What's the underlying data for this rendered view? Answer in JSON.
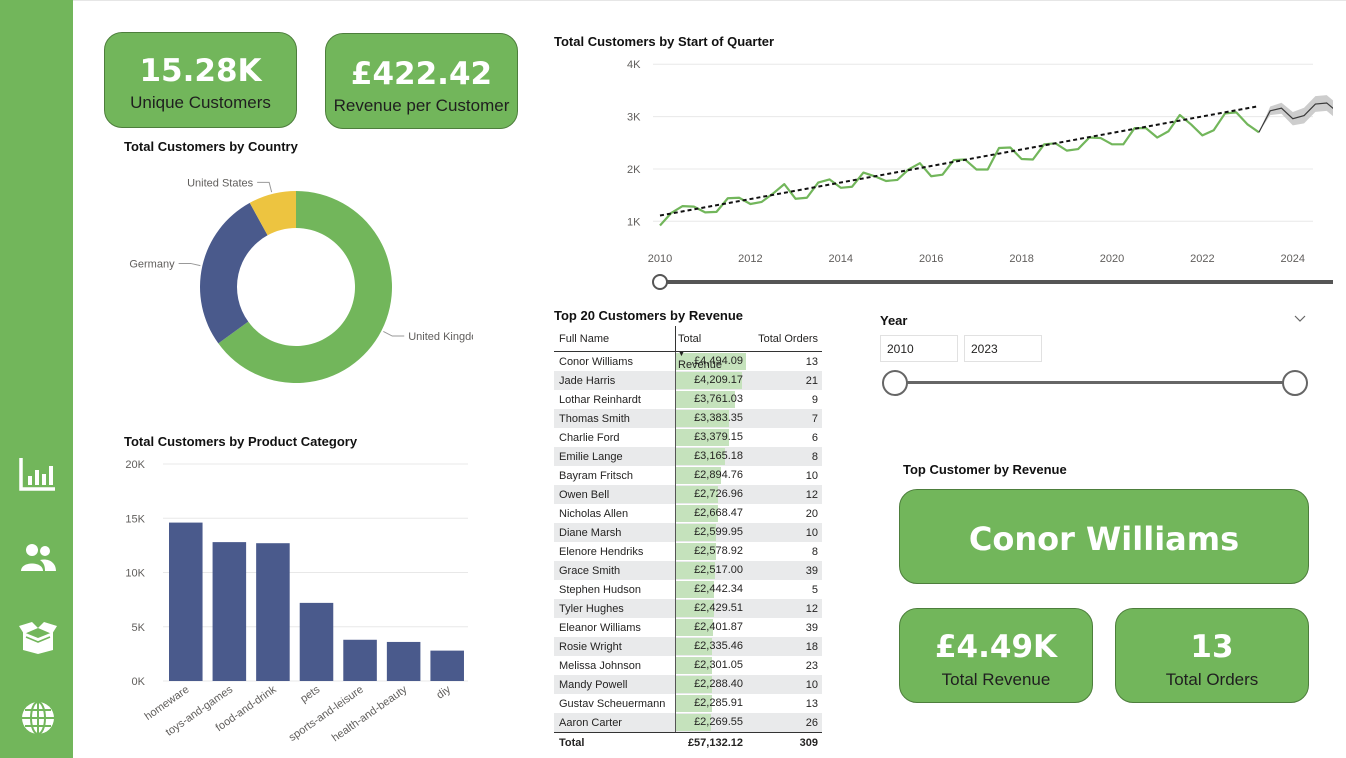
{
  "nav": [
    {
      "name": "report-icon"
    },
    {
      "name": "customers-icon"
    },
    {
      "name": "products-icon"
    },
    {
      "name": "globe-icon"
    }
  ],
  "kpis": {
    "unique_customers": {
      "value": "15.28K",
      "label": "Unique Customers"
    },
    "revenue_per_customer": {
      "value": "£422.42",
      "label": "Revenue per Customer"
    }
  },
  "country_chart": {
    "title": "Total Customers by Country",
    "chart_data": {
      "type": "pie",
      "categories": [
        "United Kingdom",
        "Germany",
        "United States"
      ],
      "values": [
        65,
        27,
        8
      ],
      "colors": [
        "#72b65b",
        "#4a5a8c",
        "#edc440"
      ]
    }
  },
  "category_chart": {
    "title": "Total Customers by Product Category",
    "chart_data": {
      "type": "bar",
      "categories": [
        "homeware",
        "toys-and-games",
        "food-and-drink",
        "pets",
        "sports-and-leisure",
        "health-and-beauty",
        "diy"
      ],
      "values": [
        14600,
        12800,
        12700,
        7200,
        3800,
        3600,
        2800
      ],
      "ylim": [
        0,
        20000
      ],
      "yticks": [
        "0K",
        "5K",
        "10K",
        "15K",
        "20K"
      ],
      "color": "#4a5a8c"
    }
  },
  "line_chart": {
    "title": "Total Customers by Start of Quarter",
    "chart_data": {
      "type": "line",
      "x_ticks": [
        "2010",
        "2012",
        "2014",
        "2016",
        "2018",
        "2020",
        "2022",
        "2024"
      ],
      "y_ticks": [
        "1K",
        "2K",
        "3K",
        "4K"
      ],
      "ylim": [
        700,
        4100
      ],
      "x_start": 2010.0,
      "x_step": 0.25,
      "actual": [
        920,
        1160,
        1290,
        1280,
        1170,
        1180,
        1440,
        1450,
        1330,
        1370,
        1530,
        1710,
        1430,
        1450,
        1740,
        1800,
        1640,
        1660,
        1930,
        1860,
        1770,
        1790,
        1990,
        2110,
        1860,
        1890,
        2170,
        2180,
        1990,
        1990,
        2400,
        2410,
        2190,
        2180,
        2470,
        2490,
        2350,
        2380,
        2600,
        2590,
        2470,
        2470,
        2780,
        2780,
        2600,
        2720,
        3030,
        2850,
        2640,
        2740,
        3060,
        3080,
        2850,
        2700
      ],
      "forecast": [
        2700,
        3110,
        3160,
        2960,
        3020,
        3240,
        3260,
        3080,
        3120,
        3380,
        3430
      ],
      "forecast_band": 150,
      "trend": [
        1110,
        3200
      ],
      "colors": {
        "actual": "#72b65b",
        "forecast": "#3a3a3a",
        "band": "#c8c8c8",
        "trend": "#111111"
      }
    }
  },
  "top20": {
    "title": "Top 20 Customers by Revenue",
    "columns": [
      "Full Name",
      "Total Revenue",
      "Total Orders"
    ],
    "rows": [
      {
        "name": "Conor Williams",
        "revenue": "£4,494.09",
        "orders": "13",
        "rev": 4494.09
      },
      {
        "name": "Jade Harris",
        "revenue": "£4,209.17",
        "orders": "21",
        "rev": 4209.17
      },
      {
        "name": "Lothar Reinhardt",
        "revenue": "£3,761.03",
        "orders": "9",
        "rev": 3761.03
      },
      {
        "name": "Thomas Smith",
        "revenue": "£3,383.35",
        "orders": "7",
        "rev": 3383.35
      },
      {
        "name": "Charlie Ford",
        "revenue": "£3,379.15",
        "orders": "6",
        "rev": 3379.15
      },
      {
        "name": "Emilie Lange",
        "revenue": "£3,165.18",
        "orders": "8",
        "rev": 3165.18
      },
      {
        "name": "Bayram Fritsch",
        "revenue": "£2,894.76",
        "orders": "10",
        "rev": 2894.76
      },
      {
        "name": "Owen Bell",
        "revenue": "£2,726.96",
        "orders": "12",
        "rev": 2726.96
      },
      {
        "name": "Nicholas Allen",
        "revenue": "£2,668.47",
        "orders": "20",
        "rev": 2668.47
      },
      {
        "name": "Diane Marsh",
        "revenue": "£2,599.95",
        "orders": "10",
        "rev": 2599.95
      },
      {
        "name": "Elenore Hendriks",
        "revenue": "£2,578.92",
        "orders": "8",
        "rev": 2578.92
      },
      {
        "name": "Grace Smith",
        "revenue": "£2,517.00",
        "orders": "39",
        "rev": 2517.0
      },
      {
        "name": "Stephen Hudson",
        "revenue": "£2,442.34",
        "orders": "5",
        "rev": 2442.34
      },
      {
        "name": "Tyler Hughes",
        "revenue": "£2,429.51",
        "orders": "12",
        "rev": 2429.51
      },
      {
        "name": "Eleanor Williams",
        "revenue": "£2,401.87",
        "orders": "39",
        "rev": 2401.87
      },
      {
        "name": "Rosie Wright",
        "revenue": "£2,335.46",
        "orders": "18",
        "rev": 2335.46
      },
      {
        "name": "Melissa Johnson",
        "revenue": "£2,301.05",
        "orders": "23",
        "rev": 2301.05
      },
      {
        "name": "Mandy Powell",
        "revenue": "£2,288.40",
        "orders": "10",
        "rev": 2288.4
      },
      {
        "name": "Gustav Scheuermann",
        "revenue": "£2,285.91",
        "orders": "13",
        "rev": 2285.91
      },
      {
        "name": "Aaron Carter",
        "revenue": "£2,269.55",
        "orders": "26",
        "rev": 2269.55
      }
    ],
    "total": {
      "label": "Total",
      "revenue": "£57,132.12",
      "orders": "309"
    }
  },
  "year_slicer": {
    "title": "Year",
    "from": "2010",
    "to": "2023",
    "chevron": "chevron-down-icon"
  },
  "top_customer": {
    "title": "Top Customer by Revenue",
    "name": "Conor Williams",
    "revenue": {
      "value": "£4.49K",
      "label": "Total Revenue"
    },
    "orders": {
      "value": "13",
      "label": "Total Orders"
    }
  }
}
